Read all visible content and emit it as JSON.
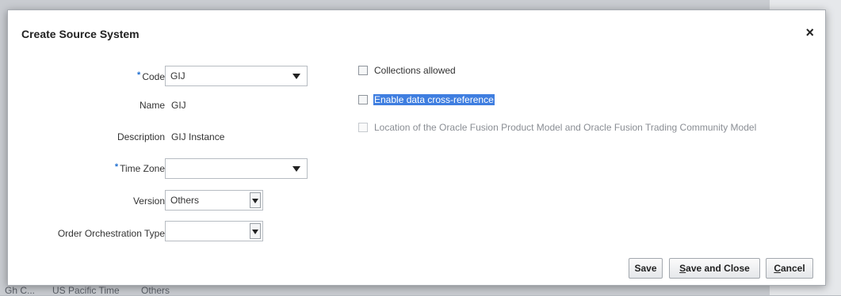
{
  "dialog": {
    "title": "Create Source System",
    "close_glyph": "×"
  },
  "form": {
    "code": {
      "label": "Code",
      "value": "GIJ",
      "required": true
    },
    "name": {
      "label": "Name",
      "value": "GIJ"
    },
    "description": {
      "label": "Description",
      "value": "GIJ Instance"
    },
    "time_zone": {
      "label": "Time Zone",
      "value": "",
      "required": true
    },
    "version": {
      "label": "Version",
      "value": "Others"
    },
    "order_orchestration_type": {
      "label": "Order Orchestration Type",
      "value": ""
    }
  },
  "checkboxes": [
    {
      "label": "Collections allowed",
      "checked": false,
      "disabled": false,
      "highlighted": false
    },
    {
      "label": "Enable data cross-reference",
      "checked": false,
      "disabled": false,
      "highlighted": true
    },
    {
      "label": "Location of the Oracle Fusion Product Model and Oracle Fusion Trading Community Model",
      "checked": false,
      "disabled": true,
      "highlighted": false
    }
  ],
  "buttons": {
    "save": "Save",
    "save_and_close_first": "S",
    "save_and_close_rest": "ave and Close",
    "cancel_first": "C",
    "cancel_rest": "ancel"
  },
  "background": {
    "bottom_cells": [
      "Gh C...",
      "US Pacific Time",
      "Others"
    ]
  },
  "colors": {
    "required_marker": "#1f6fd1",
    "highlight": "#3f7ee0"
  }
}
